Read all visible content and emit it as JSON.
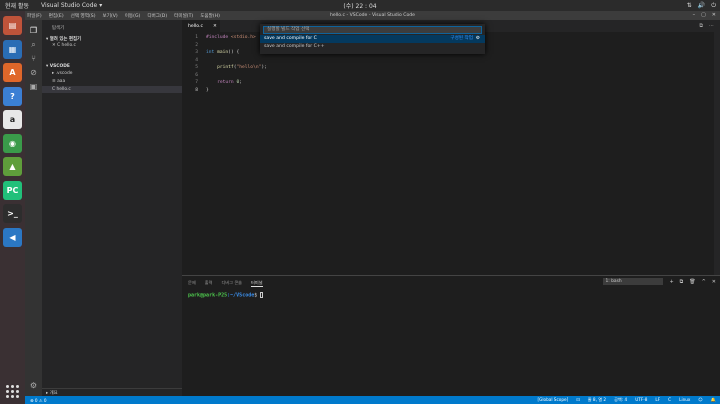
{
  "topbar": {
    "activities": "현재 활동",
    "app_name": "Visual Studio Code",
    "app_arrow": "▾",
    "clock": "(수) 22 : 04",
    "tray": [
      "⇅",
      "🔊",
      "⏻"
    ]
  },
  "window": {
    "title": "hello.c - VSCode - Visual Studio Code",
    "menu": [
      "파일(F)",
      "편집(E)",
      "선택 영역(S)",
      "보기(V)",
      "이동(G)",
      "디버그(D)",
      "터미널(T)",
      "도움말(H)"
    ],
    "controls": [
      "–",
      "▢",
      "✕"
    ]
  },
  "dock": [
    {
      "name": "files-icon",
      "glyph": "▤",
      "color": "#c0533a"
    },
    {
      "name": "writer-icon",
      "glyph": "▦",
      "color": "#2a6db5"
    },
    {
      "name": "software-center-icon",
      "glyph": "A",
      "color": "#e0672a"
    },
    {
      "name": "help-icon",
      "glyph": "?",
      "color": "#3b7fd4"
    },
    {
      "name": "amazon-icon",
      "glyph": "a",
      "color": "#e8e8e8"
    },
    {
      "name": "chrome-icon",
      "glyph": "◉",
      "color": "#3a9b4a"
    },
    {
      "name": "android-studio-icon",
      "glyph": "▲",
      "color": "#5f9e3b"
    },
    {
      "name": "pycharm-icon",
      "glyph": "PC",
      "color": "#21c07a"
    },
    {
      "name": "terminal-icon",
      "glyph": ">_",
      "color": "#2d2d2d"
    },
    {
      "name": "vscode-icon",
      "glyph": "◀",
      "color": "#2b78c4"
    }
  ],
  "activity_bar": [
    "files-icon",
    "search-icon",
    "source-control-icon",
    "debug-icon",
    "extensions-icon"
  ],
  "activity_glyphs": [
    "❐",
    "⌕",
    "⑂",
    "⊘",
    "▣"
  ],
  "settings_glyph": "⚙",
  "sidebar": {
    "header": "탐색기",
    "open_editors": "▾ 열려 있는 편집기",
    "open_file": "✕  C  hello.c",
    "project": "▾ VSCODE",
    "items": [
      {
        "label": "▸  .vscode"
      },
      {
        "label": "≡  aaa"
      },
      {
        "label": "C  hello.c"
      }
    ],
    "outline": "▸ 개요"
  },
  "editor": {
    "tab_label": "hello.c",
    "tab_close": "✕",
    "tab_icons": [
      "⧉",
      "⋯"
    ],
    "lines": [
      "1",
      "2",
      "3",
      "4",
      "5",
      "6",
      "7",
      "8"
    ]
  },
  "palette": {
    "placeholder": "실행할 빌드 작업 선택",
    "options": [
      "save and compile for C",
      "save and compile for C++"
    ],
    "configure": "구성된 작업",
    "gear": "⚙"
  },
  "panel": {
    "tabs": [
      "문제",
      "출력",
      "디버그 콘솔",
      "터미널"
    ],
    "terminal_select": "1: bash",
    "controls": [
      "+",
      "⧉",
      "🗑",
      "^",
      "✕"
    ],
    "prompt_user": "park@park-P25",
    "prompt_path": ":~/VScode",
    "prompt_end": "$ "
  },
  "status": {
    "left": "⊗ 0  ⚠ 0",
    "right": [
      "[Global Scope]",
      "⊡",
      "줄 8, 열 2",
      "공백: 4",
      "UTF-8",
      "LF",
      "C",
      "Linux",
      "☺",
      "🔔"
    ]
  }
}
